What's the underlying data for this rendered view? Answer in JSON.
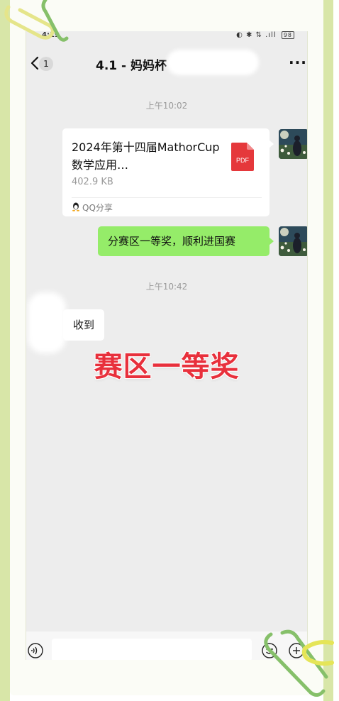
{
  "status_bar": {
    "time": "4:19",
    "icons": "◐ ✱ ⇅ .ıll",
    "battery": "98"
  },
  "header": {
    "unread_count": "1",
    "title": "4.1 - 妈妈杯",
    "more": "···"
  },
  "messages": {
    "timestamp_1": "上午10:02",
    "file": {
      "name": "2024年第十四届MathorCup数学应用…",
      "size": "402.9 KB",
      "type_label": "PDF",
      "source": "QQ分享"
    },
    "sent_text": "分赛区一等奖，顺利进国赛",
    "timestamp_2": "上午10:42",
    "received_text": "收到"
  },
  "caption": "赛区一等奖",
  "colors": {
    "sent_bubble": "#95ec69",
    "chat_background": "#ededed",
    "caption": "#e8303c",
    "frame_accent": "#d8e6a8",
    "pdf_red": "#e5383b"
  },
  "icons": [
    "back-chevron-icon",
    "more-icon",
    "pdf-file-icon",
    "qq-penguin-icon",
    "voice-icon",
    "emoji-icon",
    "plus-icon",
    "paperclip-decoration"
  ]
}
